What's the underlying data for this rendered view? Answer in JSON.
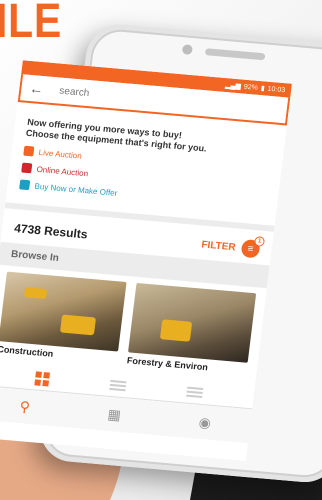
{
  "brand": {
    "fragment": "ILE"
  },
  "status": {
    "battery": "92%",
    "time": "10:03"
  },
  "search": {
    "placeholder": "search"
  },
  "offer": {
    "title_line1": "Now offering you more ways to buy!",
    "title_line2": "Choose the equipment that's right for you.",
    "options": [
      {
        "label": "Live Auction",
        "icon": "gavel-icon",
        "color": "#f26522"
      },
      {
        "label": "Online Auction",
        "icon": "online-auction-icon",
        "color": "#d0272c"
      },
      {
        "label": "Buy Now or Make Offer",
        "icon": "tag-icon",
        "color": "#1b9fc2"
      }
    ]
  },
  "results": {
    "count": "4738 Results",
    "filter_label": "FILTER",
    "filter_badge": "1"
  },
  "browse": {
    "label": "Browse In",
    "categories": [
      {
        "label": "Construction"
      },
      {
        "label": "Forestry & Environ"
      }
    ]
  },
  "colors": {
    "accent": "#f26522"
  }
}
